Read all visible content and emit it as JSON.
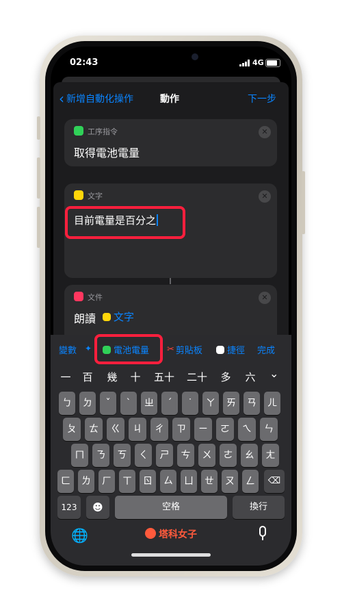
{
  "status_bar": {
    "time": "02:43",
    "network": "4G"
  },
  "nav": {
    "back_label": "新增自動化操作",
    "title": "動作",
    "next_label": "下一步"
  },
  "cards": [
    {
      "label": "工序指令",
      "title": "取得電池電量",
      "icon_color": "#30d158"
    },
    {
      "label": "文字",
      "text": "目前電量是百分之",
      "icon_color": "#ffd60a"
    },
    {
      "label": "文件",
      "verb": "朗讀",
      "token": "文字",
      "icon_color": "#ff375f"
    }
  ],
  "variable_bar": {
    "variables_label": "變數",
    "battery_level": "電池電量",
    "clipboard": "剪貼板",
    "shortcut_input": "捷徑",
    "done": "完成"
  },
  "candidates": [
    "一",
    "百",
    "幾",
    "十",
    "五十",
    "二十",
    "多",
    "六"
  ],
  "keyboard_rows": [
    [
      "ㄅ",
      "ㄉ",
      "ˇ",
      "ˋ",
      "ㄓ",
      "ˊ",
      "˙",
      "ㄚ",
      "ㄞ",
      "ㄢ",
      "ㄦ"
    ],
    [
      "ㄆ",
      "ㄊ",
      "ㄍ",
      "ㄐ",
      "ㄔ",
      "ㄗ",
      "ㄧ",
      "ㄛ",
      "ㄟ",
      "ㄣ"
    ],
    [
      "ㄇ",
      "ㄋ",
      "ㄎ",
      "ㄑ",
      "ㄕ",
      "ㄘ",
      "ㄨ",
      "ㄜ",
      "ㄠ",
      "ㄤ"
    ],
    [
      "ㄈ",
      "ㄌ",
      "ㄏ",
      "ㄒ",
      "ㄖ",
      "ㄙ",
      "ㄩ",
      "ㄝ",
      "ㄡ",
      "ㄥ"
    ]
  ],
  "bottom_keys": {
    "numbers": "123",
    "emoji": "☻",
    "space": "空格",
    "return": "換行"
  },
  "watermark": "塔科女子",
  "colors": {
    "accent": "#0a84ff",
    "highlight": "#ff1f3d"
  }
}
